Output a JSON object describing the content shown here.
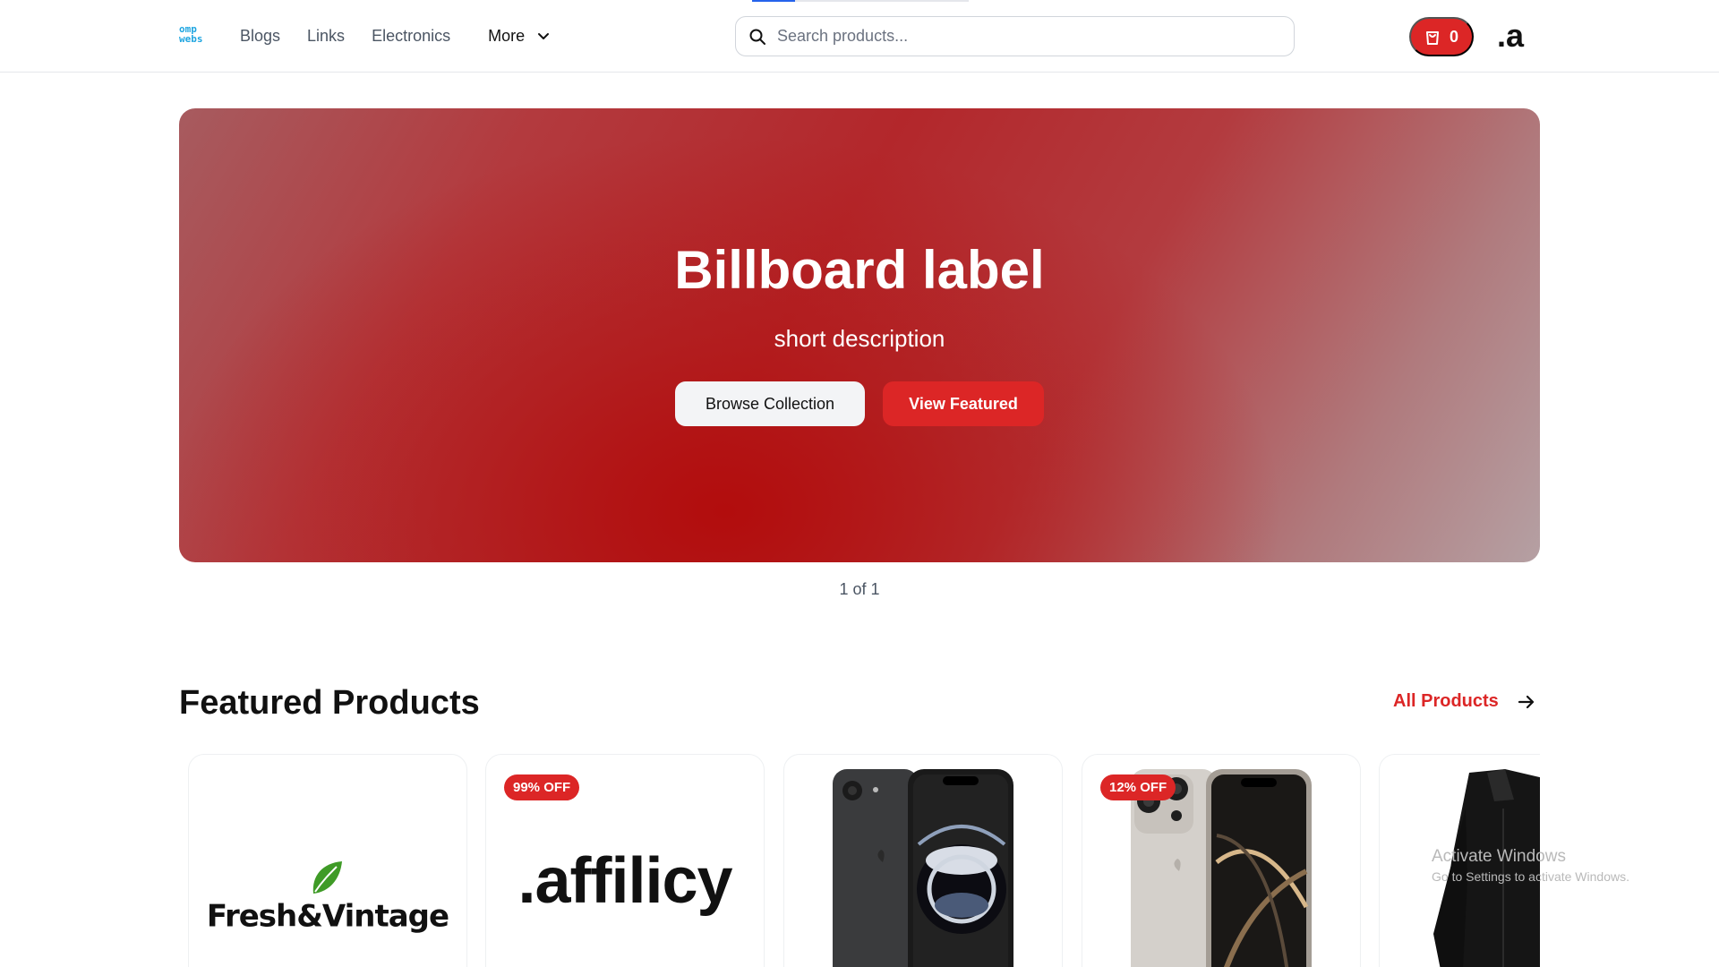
{
  "header": {
    "logo_line1": "omp",
    "logo_line2": "webs",
    "nav": [
      "Blogs",
      "Links",
      "Electronics"
    ],
    "more_label": "More",
    "search_placeholder": "Search products...",
    "cart_count": "0",
    "brand_mark": ".a"
  },
  "billboard": {
    "title": "Billboard label",
    "description": "short description",
    "browse_label": "Browse Collection",
    "featured_label": "View Featured",
    "pager": "1 of 1"
  },
  "featured": {
    "title": "Featured Products",
    "all_products_label": "All Products",
    "products": [
      {
        "logo_text": "Fresh&Vintage",
        "badge": ""
      },
      {
        "logo_text": ".affilicy",
        "badge": "99% OFF"
      },
      {
        "logo_text": "",
        "badge": ""
      },
      {
        "logo_text": "",
        "badge": "12% OFF"
      },
      {
        "logo_text": "",
        "badge": ""
      }
    ]
  },
  "watermark": {
    "line1": "Activate Windows",
    "line2": "Go to Settings to activate Windows."
  },
  "colors": {
    "accent": "#dc2626",
    "logo": "#1fa5e0"
  }
}
